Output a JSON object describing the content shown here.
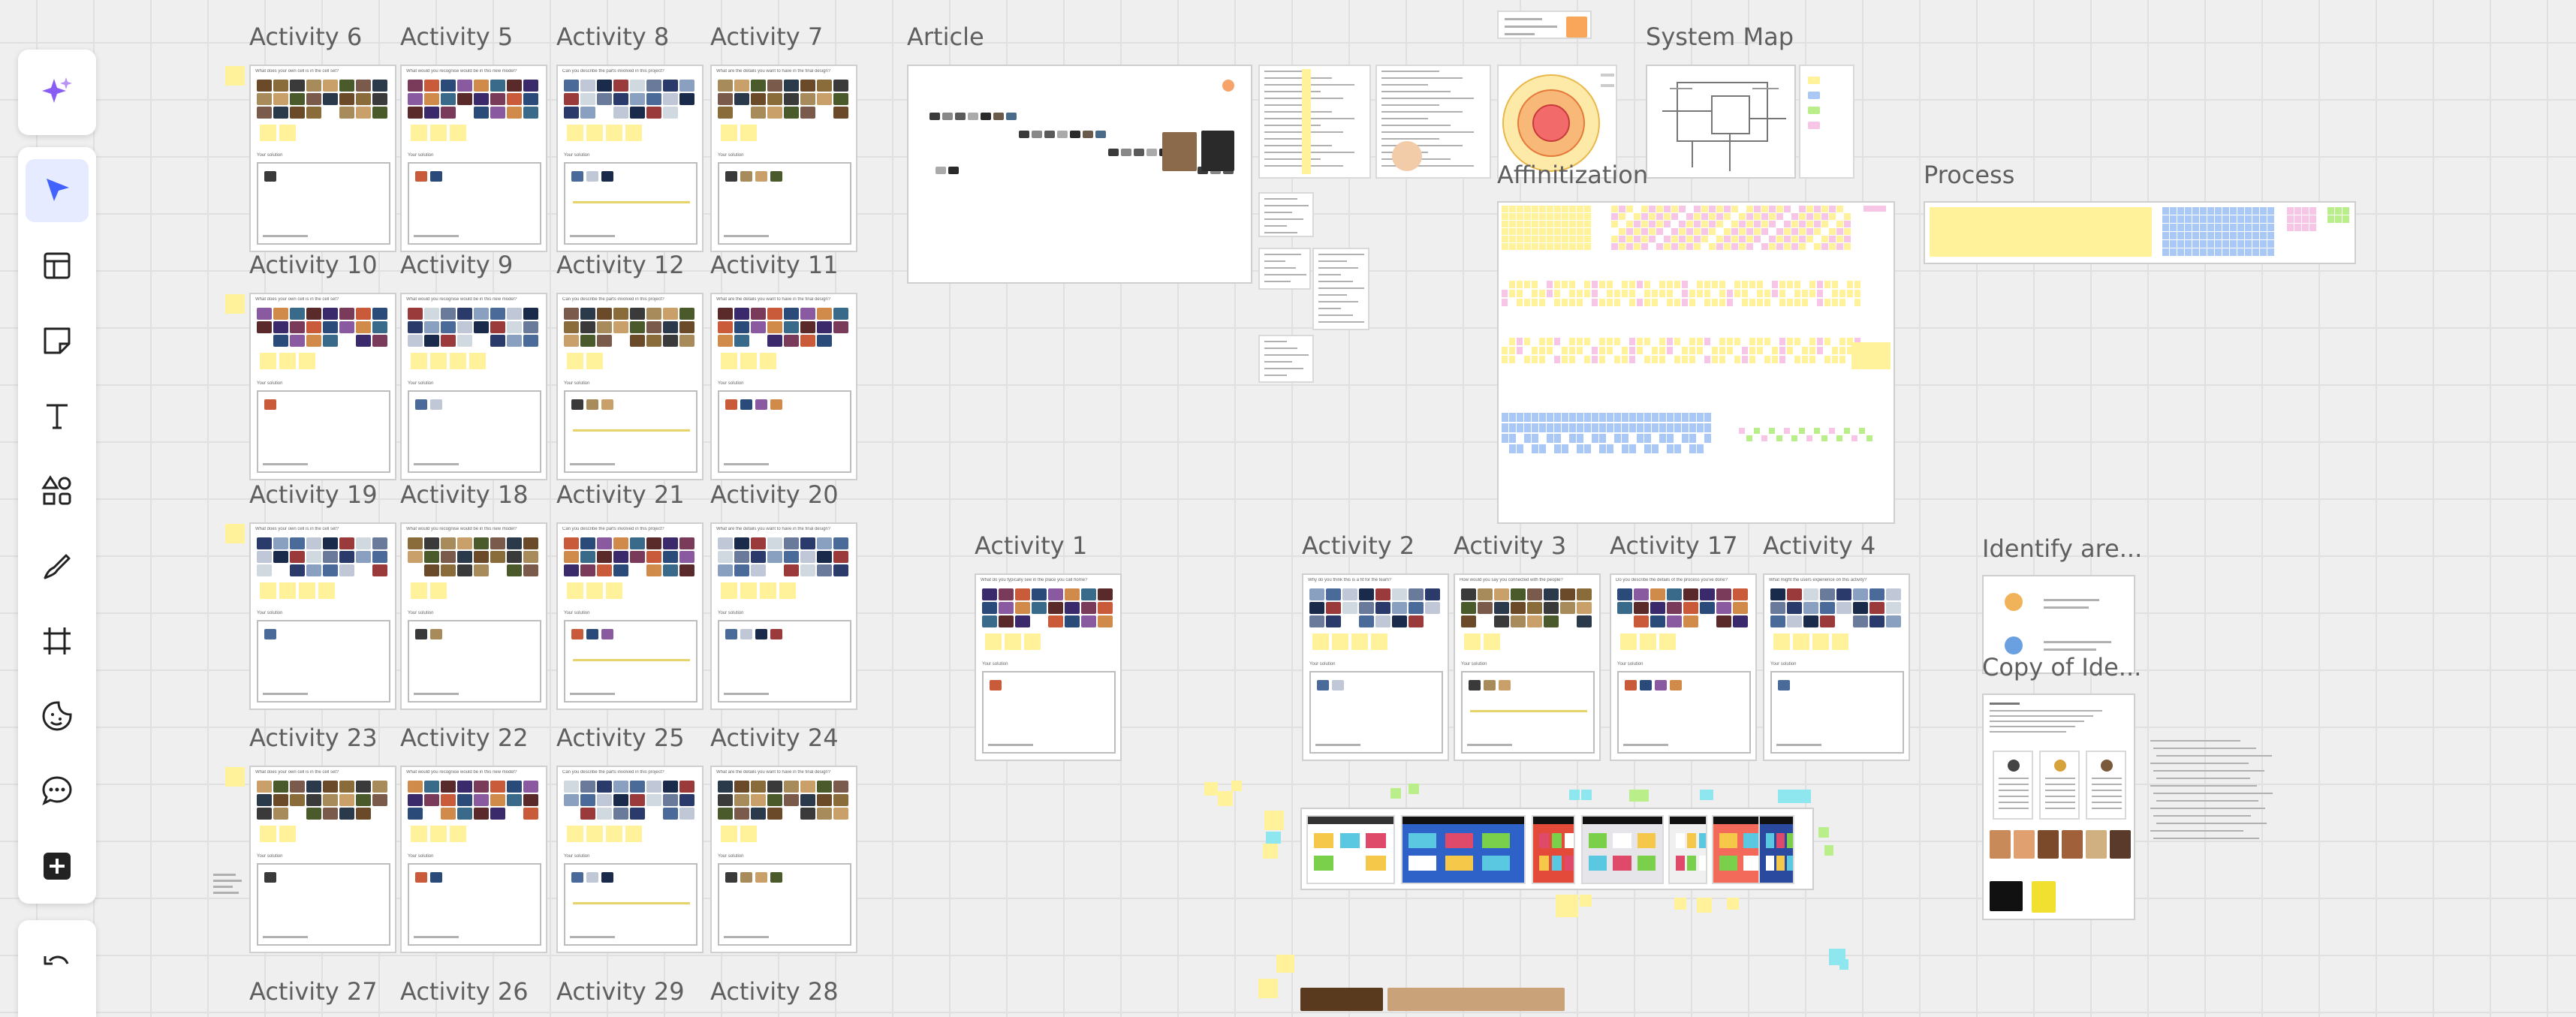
{
  "board": {
    "activity_frames": [
      {
        "label": "Activity 6",
        "question": "What does your own cell is in the cell set?",
        "heading": "Your solution"
      },
      {
        "label": "Activity 5",
        "question": "What would you recognise would be in this new model?",
        "heading": "Your solution"
      },
      {
        "label": "Activity 8",
        "question": "Can you describe the parts involved in this project?",
        "heading": "Your solution"
      },
      {
        "label": "Activity 7",
        "question": "What are the details you want to have in the final design?",
        "heading": "Your solution"
      },
      {
        "label": "Activity 10",
        "question": "What does your own cell is in the cell set?",
        "heading": "Your solution"
      },
      {
        "label": "Activity 9",
        "question": "What would you recognise would be in this new model?",
        "heading": "Your solution"
      },
      {
        "label": "Activity 12",
        "question": "Can you describe the parts involved in this project?",
        "heading": "Your solution"
      },
      {
        "label": "Activity 11",
        "question": "What are the details you want to have in the final design?",
        "heading": "Your solution"
      },
      {
        "label": "Activity 19",
        "question": "What does your own cell is in the cell set?",
        "heading": "Your solution"
      },
      {
        "label": "Activity 18",
        "question": "What would you recognise would be in this new model?",
        "heading": "Your solution"
      },
      {
        "label": "Activity 21",
        "question": "Can you describe the parts involved in this project?",
        "heading": "Your solution"
      },
      {
        "label": "Activity 20",
        "question": "What are the details you want to have in the final design?",
        "heading": "Your solution"
      },
      {
        "label": "Activity 23",
        "question": "What does your own cell is in the cell set?",
        "heading": "Your solution"
      },
      {
        "label": "Activity 22",
        "question": "What would you recognise would be in this new model?",
        "heading": "Your solution"
      },
      {
        "label": "Activity 25",
        "question": "Can you describe the parts involved in this project?",
        "heading": "Your solution"
      },
      {
        "label": "Activity 24",
        "question": "What are the details you want to have in the final design?",
        "heading": "Your solution"
      },
      {
        "label": "Activity 1",
        "question": "What do you typically see in the place you call home?",
        "heading": "Your solution"
      },
      {
        "label": "Activity 2",
        "question": "Why do you think this is a fit for the team?",
        "heading": "Your solution"
      },
      {
        "label": "Activity 3",
        "question": "How would you say you connected with the people?",
        "heading": "Your solution"
      },
      {
        "label": "Activity 17",
        "question": "Do you describe the details of the process you've done?",
        "heading": "Your solution"
      },
      {
        "label": "Activity 4",
        "question": "What might the users experience on this activity?",
        "heading": "Your solution"
      }
    ],
    "partial_labels": [
      "Activity 27",
      "Activity 26",
      "Activity 29",
      "Activity 28"
    ],
    "section_labels": {
      "article": "Article",
      "system_map": "System Map",
      "affinitization": "Affinitization",
      "process": "Process",
      "identify": "Identify are...",
      "copy_of_identify": "Copy of Ide..."
    },
    "colors": {
      "sticky_yellow": "#fff29a",
      "sticky_pink": "#f7c6e6",
      "sticky_blue": "#a9c8f5",
      "sticky_green": "#b9ee8a",
      "sticky_cyan": "#8ee6ee",
      "frame_border": "#cfcfcf",
      "accent": "#4262ff"
    }
  },
  "toolbar": {
    "tools": [
      {
        "name": "ai-sparkle-icon",
        "label": "AI assist"
      },
      {
        "name": "select-cursor-icon",
        "label": "Select",
        "active": true
      },
      {
        "name": "templates-icon",
        "label": "Templates"
      },
      {
        "name": "sticky-note-icon",
        "label": "Sticky note"
      },
      {
        "name": "text-icon",
        "label": "Text"
      },
      {
        "name": "shapes-icon",
        "label": "Shapes"
      },
      {
        "name": "pen-icon",
        "label": "Pen"
      },
      {
        "name": "frame-icon",
        "label": "Frame"
      },
      {
        "name": "stickers-icon",
        "label": "Stickers"
      },
      {
        "name": "comment-icon",
        "label": "Comment"
      },
      {
        "name": "add-more-icon",
        "label": "More apps"
      },
      {
        "name": "undo-icon",
        "label": "Undo"
      }
    ]
  }
}
